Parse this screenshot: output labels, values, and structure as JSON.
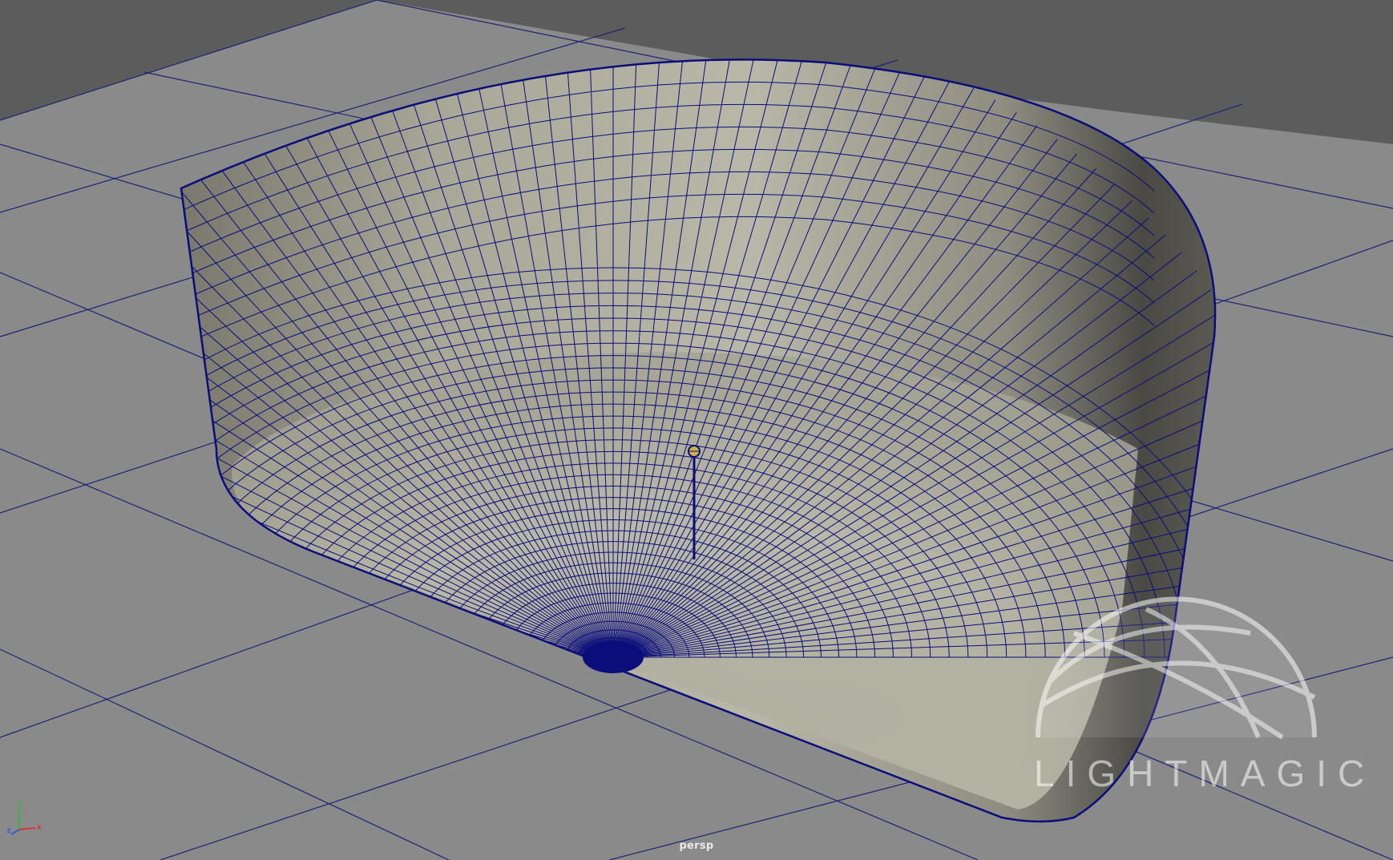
{
  "viewport": {
    "camera_label": "persp",
    "background_color": "#5c5c5c",
    "ground_color": "#8a8a8a",
    "grid_line_color": "#1a1f6e",
    "wireframe_color": "#0a0d7a",
    "surface_color": "#a8a695"
  },
  "axis": {
    "x": "x",
    "y": "y",
    "z": "z",
    "x_color": "#d23a3a",
    "y_color": "#3ab34a",
    "z_color": "#3a5ad2"
  },
  "watermark": {
    "text": "LIGHTMAGIC",
    "icon": "globe-arcs-icon"
  },
  "object": {
    "name": "polygon-bowl-mesh",
    "pivot_icon": "locator-pin-icon"
  }
}
